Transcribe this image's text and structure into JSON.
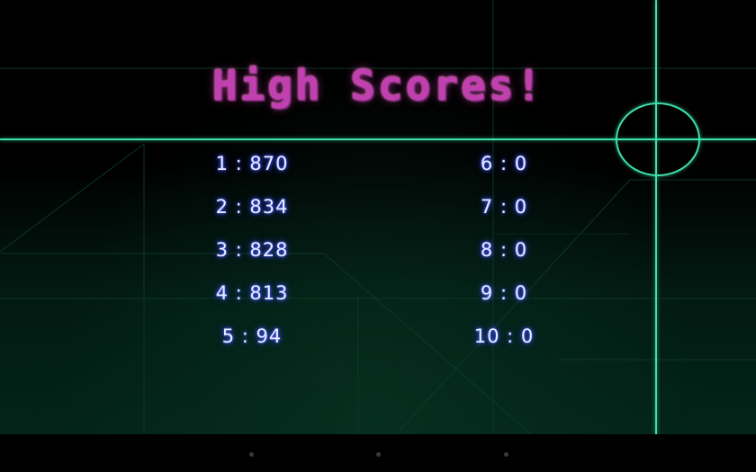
{
  "screen": {
    "title": "High Scores!"
  },
  "scores": {
    "left": [
      {
        "entry": "1 : 870"
      },
      {
        "entry": "2 : 834"
      },
      {
        "entry": "3 : 828"
      },
      {
        "entry": "4 : 813"
      },
      {
        "entry": "5 : 94"
      }
    ],
    "right": [
      {
        "entry": "6 : 0"
      },
      {
        "entry": "7 : 0"
      },
      {
        "entry": "8 : 0"
      },
      {
        "entry": "9 : 0"
      },
      {
        "entry": "10 : 0"
      }
    ]
  },
  "colors": {
    "title": "#c040b0",
    "score_text": "#e8ecff",
    "score_glow": "#3a48ff",
    "crosshair": "#3ee0a8",
    "grid": "#0e3a28"
  },
  "icons": {
    "crosshair": "crosshair-icon",
    "nav_back": "nav-back-icon",
    "nav_home": "nav-home-icon",
    "nav_recent": "nav-recent-apps-icon"
  }
}
